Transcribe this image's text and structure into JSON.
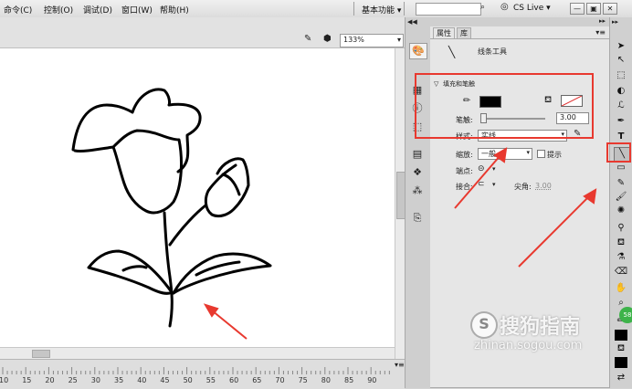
{
  "menubar": {
    "items": [
      "命令(C)",
      "控制(O)",
      "调试(D)",
      "窗口(W)",
      "帮助(H)"
    ],
    "workspace": "基本功能",
    "cs_live": "CS Live"
  },
  "stage": {
    "zoom": "133%"
  },
  "timeline": {
    "ticks": [
      "10",
      "15",
      "20",
      "25",
      "30",
      "35",
      "40",
      "45",
      "50",
      "55",
      "60",
      "65",
      "70",
      "75",
      "80",
      "85",
      "90"
    ]
  },
  "props": {
    "tab_properties": "属性",
    "tab_library": "库",
    "tool_name": "线条工具",
    "section_fill_stroke": "填充和笔触",
    "stroke_label": "笔触:",
    "stroke_value": "3.00",
    "style_label": "样式:",
    "style_value": "实线",
    "scale_label": "缩放:",
    "scale_value": "一般",
    "hint_label": "提示",
    "cap_label": "端点:",
    "join_label": "接合:",
    "miter_label": "尖角:",
    "miter_value": "3.00"
  },
  "watermark": {
    "brand": "搜狗指南",
    "url": "zhinan.sogou.com",
    "badge": "58"
  },
  "colors": {
    "annotation": "#e8392f",
    "stroke_color": "#000000"
  }
}
